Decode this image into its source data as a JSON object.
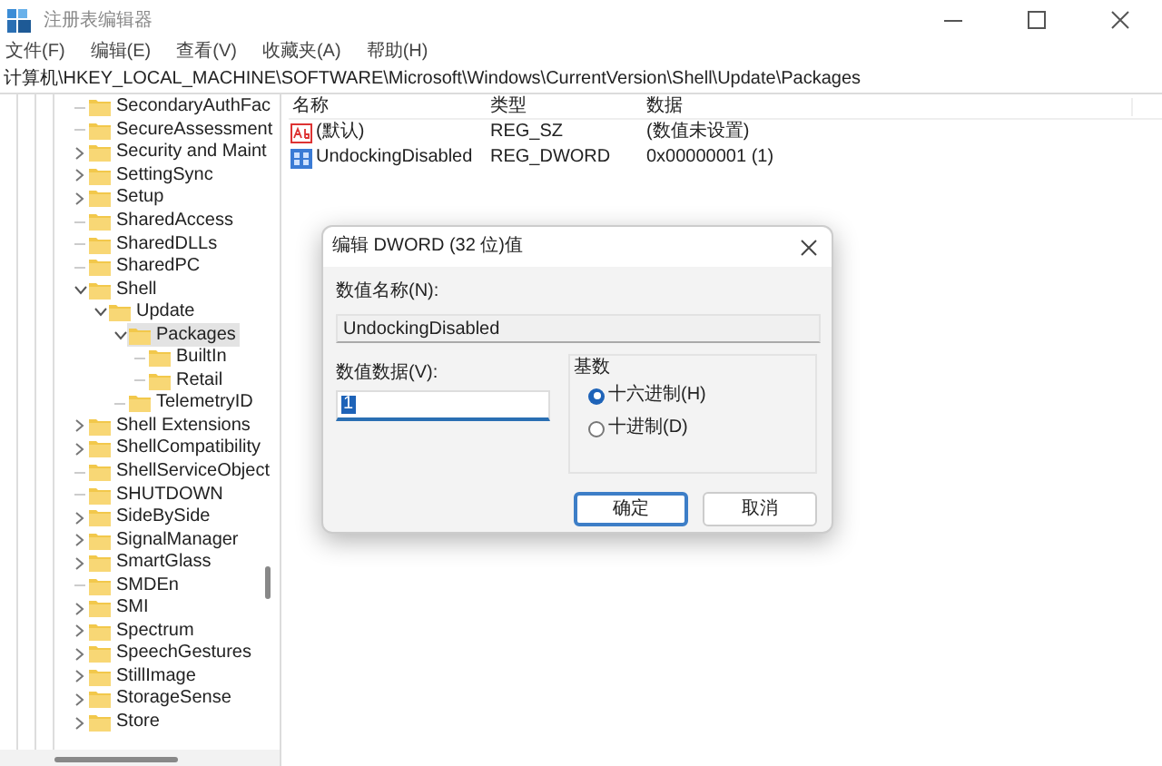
{
  "window": {
    "title": "注册表编辑器"
  },
  "menu": [
    "文件(F)",
    "编辑(E)",
    "查看(V)",
    "收藏夹(A)",
    "帮助(H)"
  ],
  "address": "计算机\\HKEY_LOCAL_MACHINE\\SOFTWARE\\Microsoft\\Windows\\CurrentVersion\\Shell\\Update\\Packages",
  "tree": [
    {
      "name": "SecondaryAuthFac",
      "kind": "leaf",
      "selected": false
    },
    {
      "name": "SecureAssessment",
      "kind": "leaf",
      "selected": false
    },
    {
      "name": "Security and Maint",
      "kind": "collapsed",
      "selected": false
    },
    {
      "name": "SettingSync",
      "kind": "collapsed",
      "selected": false
    },
    {
      "name": "Setup",
      "kind": "collapsed",
      "selected": false
    },
    {
      "name": "SharedAccess",
      "kind": "leaf",
      "selected": false
    },
    {
      "name": "SharedDLLs",
      "kind": "leaf",
      "selected": false
    },
    {
      "name": "SharedPC",
      "kind": "leaf",
      "selected": false
    },
    {
      "name": "Shell",
      "kind": "expanded",
      "selected": false,
      "children": [
        {
          "name": "Update",
          "kind": "expanded",
          "selected": false,
          "children": [
            {
              "name": "Packages",
              "kind": "expanded",
              "selected": true,
              "children": [
                {
                  "name": "BuiltIn",
                  "kind": "leaf",
                  "selected": false
                },
                {
                  "name": "Retail",
                  "kind": "leaf",
                  "selected": false
                }
              ]
            },
            {
              "name": "TelemetryID",
              "kind": "leaf",
              "selected": false
            }
          ]
        }
      ]
    },
    {
      "name": "Shell Extensions",
      "kind": "collapsed",
      "selected": false
    },
    {
      "name": "ShellCompatibility",
      "kind": "collapsed",
      "selected": false
    },
    {
      "name": "ShellServiceObject",
      "kind": "leaf",
      "selected": false
    },
    {
      "name": "SHUTDOWN",
      "kind": "leaf",
      "selected": false
    },
    {
      "name": "SideBySide",
      "kind": "collapsed",
      "selected": false
    },
    {
      "name": "SignalManager",
      "kind": "collapsed",
      "selected": false
    },
    {
      "name": "SmartGlass",
      "kind": "collapsed",
      "selected": false
    },
    {
      "name": "SMDEn",
      "kind": "leaf",
      "selected": false
    },
    {
      "name": "SMI",
      "kind": "collapsed",
      "selected": false
    },
    {
      "name": "Spectrum",
      "kind": "collapsed",
      "selected": false
    },
    {
      "name": "SpeechGestures",
      "kind": "collapsed",
      "selected": false
    },
    {
      "name": "StillImage",
      "kind": "collapsed",
      "selected": false
    },
    {
      "name": "StorageSense",
      "kind": "collapsed",
      "selected": false
    },
    {
      "name": "Store",
      "kind": "collapsed",
      "selected": false
    }
  ],
  "values_table": {
    "columns": [
      "名称",
      "类型",
      "数据"
    ],
    "rows": [
      {
        "kind": "string",
        "name": "(默认)",
        "type": "REG_SZ",
        "data": "(数值未设置)"
      },
      {
        "kind": "binary",
        "name": "UndockingDisabled",
        "type": "REG_DWORD",
        "data": "0x00000001 (1)"
      }
    ]
  },
  "dialog": {
    "title": "编辑 DWORD (32 位)值",
    "name_label": "数值名称(N):",
    "name_value": "UndockingDisabled",
    "data_label": "数值数据(V):",
    "data_value": "1",
    "base_label": "基数",
    "radios": [
      {
        "label": "十六进制(H)",
        "selected": true
      },
      {
        "label": "十进制(D)",
        "selected": false
      }
    ],
    "buttons": [
      {
        "label": "确定",
        "primary": true
      },
      {
        "label": "取消",
        "primary": false
      }
    ]
  }
}
